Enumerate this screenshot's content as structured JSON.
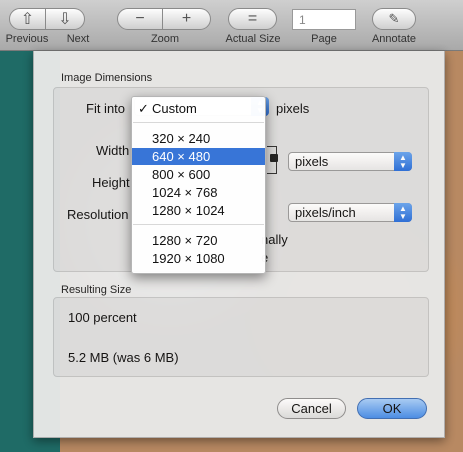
{
  "toolbar": {
    "page_value": "1",
    "labels": {
      "previous": "Previous",
      "next": "Next",
      "zoom": "Zoom",
      "actual_size": "Actual Size",
      "page": "Page",
      "annotate": "Annotate"
    }
  },
  "dialog": {
    "image_dimensions_title": "Image Dimensions",
    "fit_into_label": "Fit into",
    "fit_into_units": "pixels",
    "width_label": "Width",
    "height_label": "Height",
    "resolution_label": "Resolution",
    "units_popup": "pixels",
    "resolution_units_popup": "pixels/inch",
    "scale_partial_text": "nally",
    "resample_partial_text": "e",
    "resulting_size_title": "Resulting Size",
    "percent_text": "100 percent",
    "size_text": "5.2 MB (was 6 MB)",
    "cancel_label": "Cancel",
    "ok_label": "OK"
  },
  "fit_menu": {
    "checkmark": "✓",
    "items": [
      {
        "label": "Custom"
      },
      {
        "label": "320 × 240"
      },
      {
        "label": "640 × 480"
      },
      {
        "label": "800 × 600"
      },
      {
        "label": "1024 × 768"
      },
      {
        "label": "1280 × 1024"
      },
      {
        "label": "1280 × 720"
      },
      {
        "label": "1920 × 1080"
      }
    ],
    "selected": "640 × 480",
    "checked": "Custom"
  },
  "colors": {
    "accent": "#3875d7",
    "ok_button": "#4a8ee8"
  },
  "icons": {
    "previous": "arrow-up-icon",
    "next": "arrow-down-icon",
    "zoom_out": "minus-icon",
    "zoom_in": "plus-icon",
    "actual_size": "equals-icon",
    "annotate": "pencil-icon",
    "lock": "lock-icon"
  }
}
